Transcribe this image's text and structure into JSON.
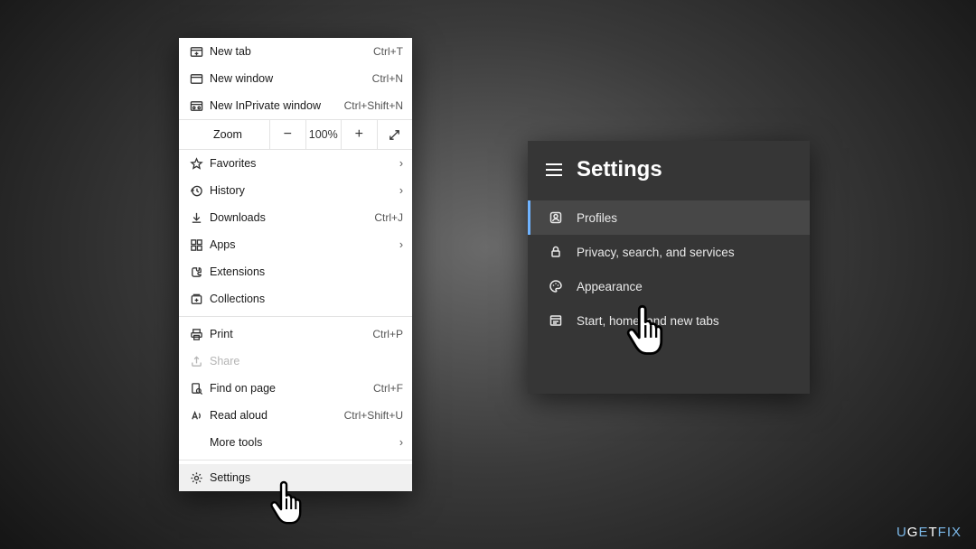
{
  "edge_menu": {
    "new_tab": {
      "label": "New tab",
      "shortcut": "Ctrl+T"
    },
    "new_win": {
      "label": "New window",
      "shortcut": "Ctrl+N"
    },
    "inprivate": {
      "label": "New InPrivate window",
      "shortcut": "Ctrl+Shift+N"
    },
    "zoom": {
      "label": "Zoom",
      "value": "100%"
    },
    "favorites": {
      "label": "Favorites"
    },
    "history": {
      "label": "History"
    },
    "downloads": {
      "label": "Downloads",
      "shortcut": "Ctrl+J"
    },
    "apps": {
      "label": "Apps"
    },
    "extensions": {
      "label": "Extensions"
    },
    "collections": {
      "label": "Collections"
    },
    "print": {
      "label": "Print",
      "shortcut": "Ctrl+P"
    },
    "share": {
      "label": "Share"
    },
    "find": {
      "label": "Find on page",
      "shortcut": "Ctrl+F"
    },
    "read": {
      "label": "Read aloud",
      "shortcut": "Ctrl+Shift+U"
    },
    "more": {
      "label": "More tools"
    },
    "settings": {
      "label": "Settings"
    }
  },
  "settings_panel": {
    "title": "Settings",
    "items": {
      "profiles": {
        "label": "Profiles"
      },
      "privacy": {
        "label": "Privacy, search, and services"
      },
      "appearance": {
        "label": "Appearance"
      },
      "start": {
        "label": "Start, home, and new tabs"
      }
    }
  },
  "watermark": "UGETFIX"
}
